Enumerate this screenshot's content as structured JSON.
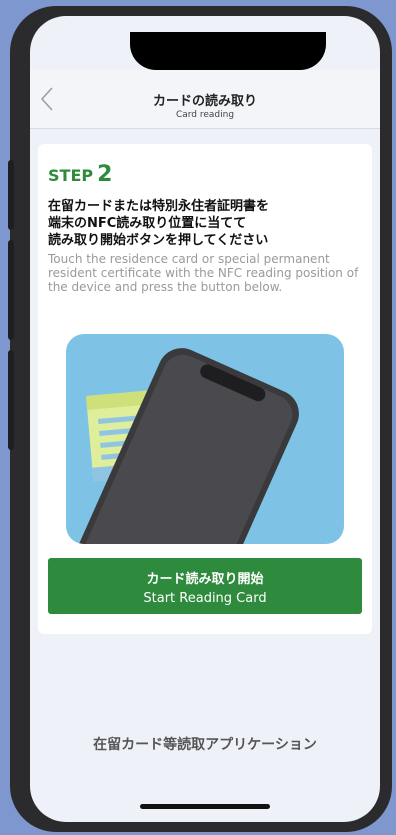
{
  "header": {
    "title_ja": "カードの読み取り",
    "title_en": "Card reading",
    "back_icon": "chevron-left-icon"
  },
  "step": {
    "word": "STEP",
    "number": "2"
  },
  "instructions": {
    "ja_lines": [
      "在留カードまたは特別永住者証明書を",
      "端末のNFC読み取り位置に当てて",
      "読み取り開始ボタンを押してください"
    ],
    "en": "Touch the residence card or special permanent resident certificate with the NFC reading position of the device and press the button below."
  },
  "start_button": {
    "label_ja": "カード読み取り開始",
    "label_en": "Start Reading Card"
  },
  "footer": {
    "app_name": "在留カード等読取アプリケーション"
  },
  "colors": {
    "accent_green": "#2e8b3d",
    "illustration_bg": "#7ec3e6",
    "card_yellow": "#dfee9a",
    "page_bg": "#7e97cf"
  }
}
